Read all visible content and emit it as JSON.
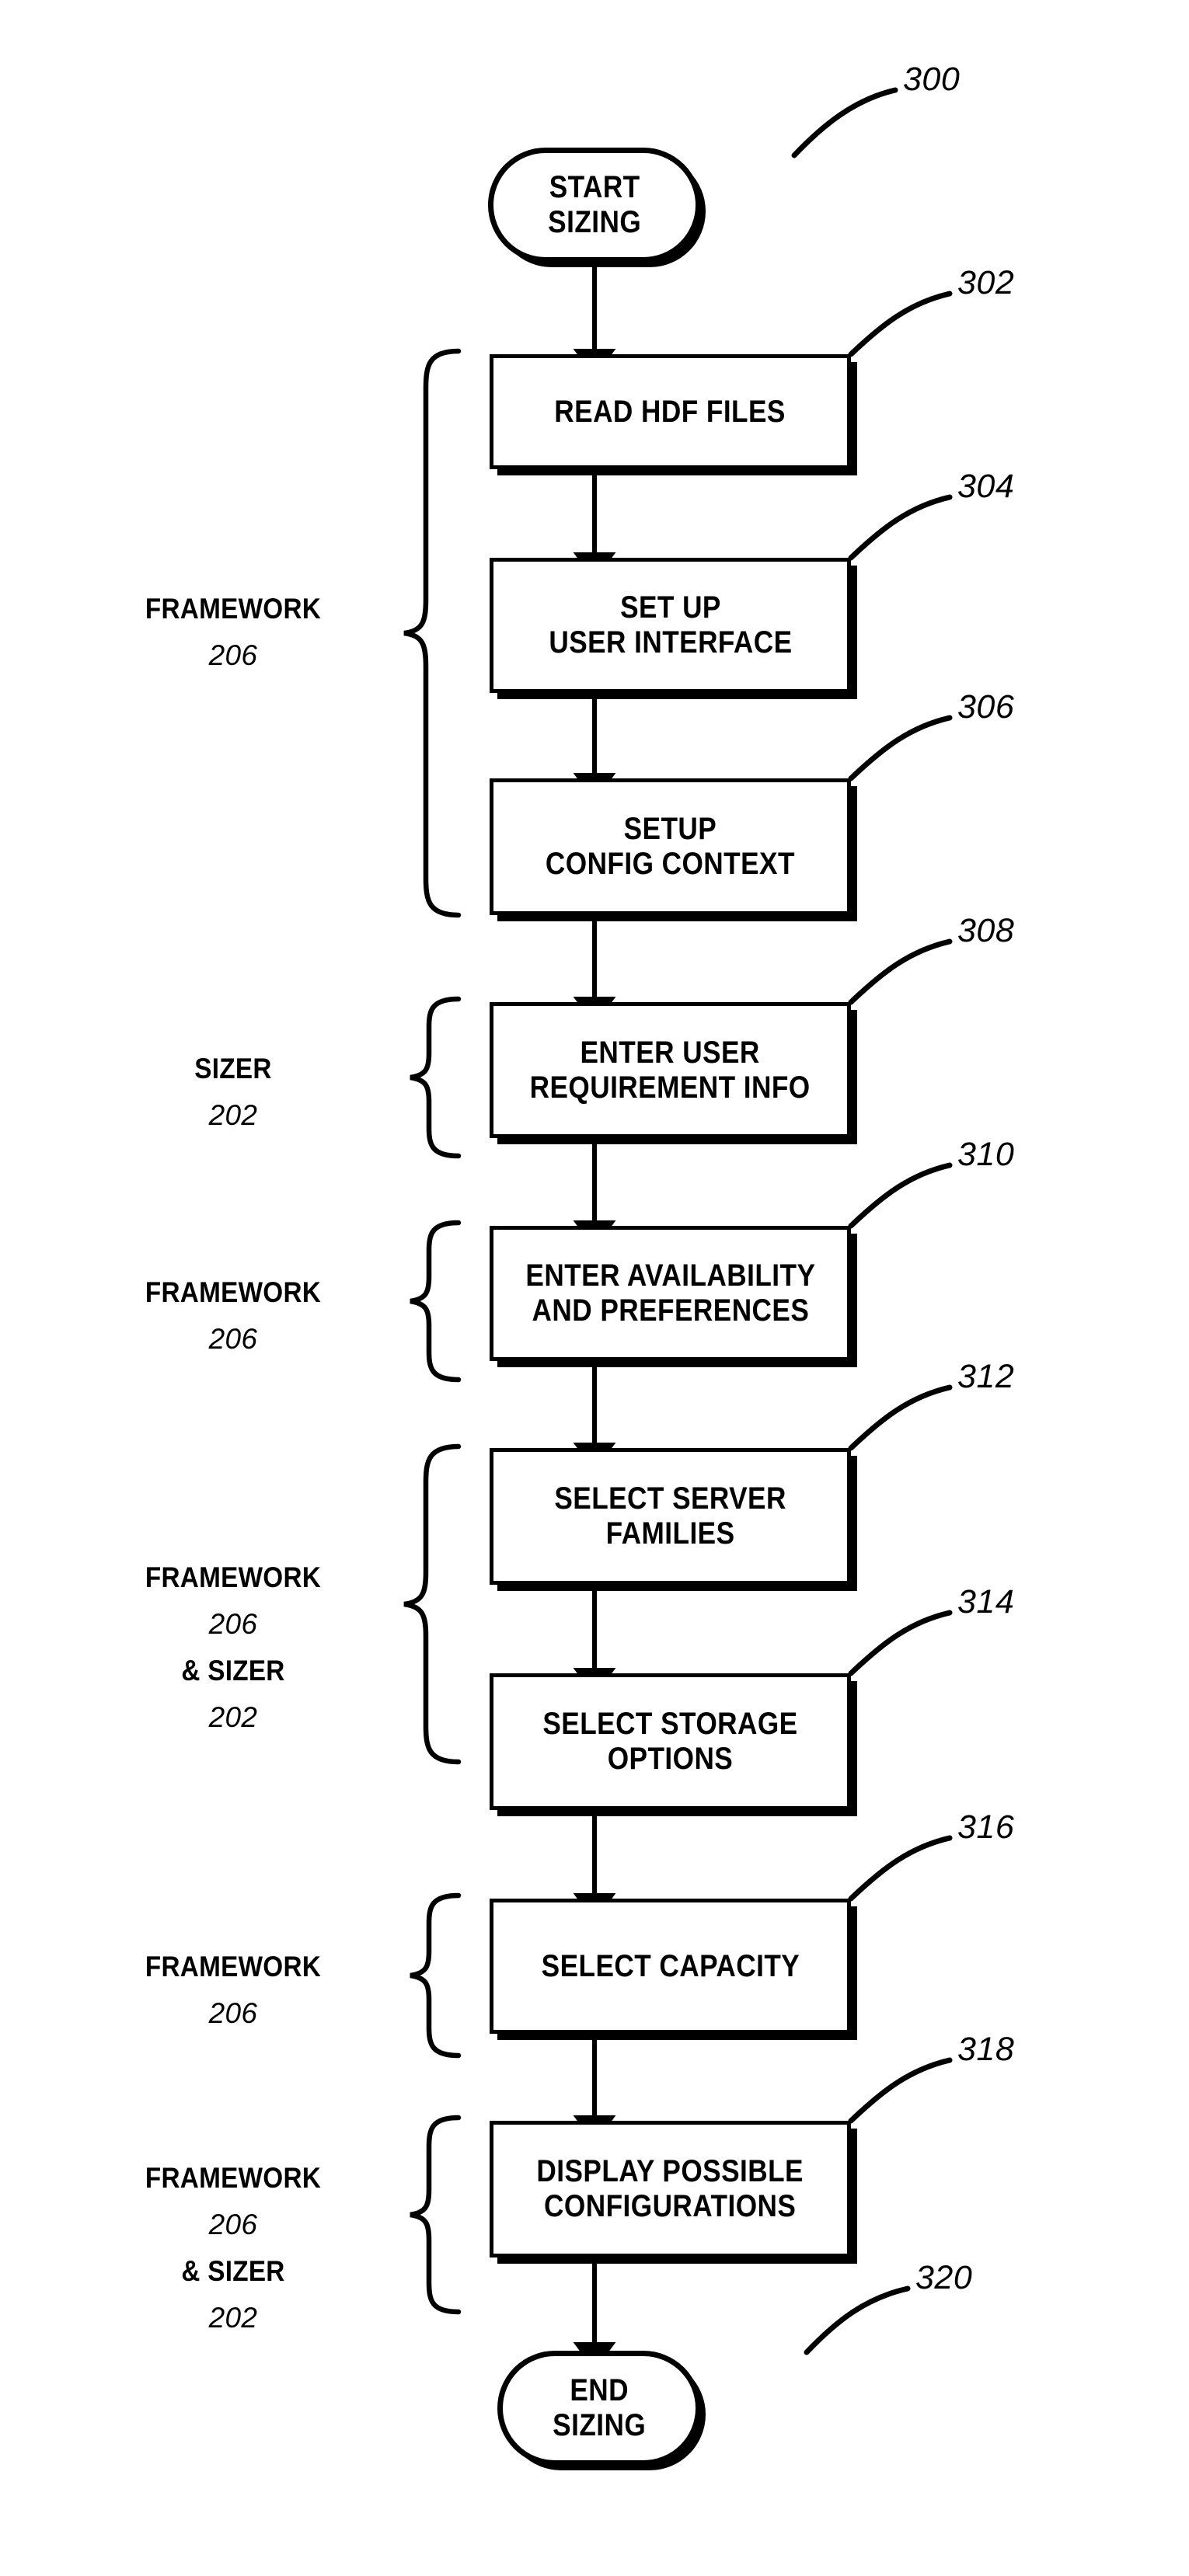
{
  "figure": {
    "title": "Sizing process flowchart",
    "ink_color": "#000000",
    "background_color": "#ffffff"
  },
  "nodes": [
    {
      "id": "start",
      "shape": "terminal",
      "label": "START\nSIZING",
      "ref": "300"
    },
    {
      "id": "read-hdf-files",
      "shape": "process",
      "label": "READ HDF FILES",
      "ref": "302"
    },
    {
      "id": "set-up-user-interface",
      "shape": "process",
      "label": "SET UP\nUSER INTERFACE",
      "ref": "304"
    },
    {
      "id": "setup-config-context",
      "shape": "process",
      "label": "SETUP\nCONFIG CONTEXT",
      "ref": "306"
    },
    {
      "id": "enter-user-requirement-info",
      "shape": "process",
      "label": "ENTER USER\nREQUIREMENT INFO",
      "ref": "308"
    },
    {
      "id": "enter-availability-and-preferences",
      "shape": "process",
      "label": "ENTER AVAILABILITY\nAND PREFERENCES",
      "ref": "310"
    },
    {
      "id": "select-server-families",
      "shape": "process",
      "label": "SELECT SERVER\nFAMILIES",
      "ref": "312"
    },
    {
      "id": "select-storage-options",
      "shape": "process",
      "label": "SELECT STORAGE\nOPTIONS",
      "ref": "314"
    },
    {
      "id": "select-capacity",
      "shape": "process",
      "label": "SELECT CAPACITY",
      "ref": "316"
    },
    {
      "id": "display-possible-configurations",
      "shape": "process",
      "label": "DISPLAY POSSIBLE\nCONFIGURATIONS",
      "ref": "318"
    },
    {
      "id": "end",
      "shape": "terminal",
      "label": "END\nSIZING",
      "ref": "320"
    }
  ],
  "groups": [
    {
      "id": "group-framework-1",
      "lines": [
        {
          "text": "FRAMEWORK",
          "style": "name"
        },
        {
          "text": "206",
          "style": "num"
        }
      ],
      "covers": [
        "read-hdf-files",
        "set-up-user-interface",
        "setup-config-context"
      ]
    },
    {
      "id": "group-sizer-1",
      "lines": [
        {
          "text": "SIZER",
          "style": "name"
        },
        {
          "text": "202",
          "style": "num"
        }
      ],
      "covers": [
        "enter-user-requirement-info"
      ]
    },
    {
      "id": "group-framework-2",
      "lines": [
        {
          "text": "FRAMEWORK",
          "style": "name"
        },
        {
          "text": "206",
          "style": "num"
        }
      ],
      "covers": [
        "enter-availability-and-preferences"
      ]
    },
    {
      "id": "group-framework-sizer-1",
      "lines": [
        {
          "text": "FRAMEWORK",
          "style": "name"
        },
        {
          "text": "206",
          "style": "num"
        },
        {
          "text": "& SIZER",
          "style": "name"
        },
        {
          "text": "202",
          "style": "num"
        }
      ],
      "covers": [
        "select-server-families",
        "select-storage-options"
      ]
    },
    {
      "id": "group-framework-3",
      "lines": [
        {
          "text": "FRAMEWORK",
          "style": "name"
        },
        {
          "text": "206",
          "style": "num"
        }
      ],
      "covers": [
        "select-capacity"
      ]
    },
    {
      "id": "group-framework-sizer-2",
      "lines": [
        {
          "text": "FRAMEWORK",
          "style": "name"
        },
        {
          "text": "206",
          "style": "num"
        },
        {
          "text": "& SIZER",
          "style": "name"
        },
        {
          "text": "202",
          "style": "num"
        }
      ],
      "covers": [
        "display-possible-configurations"
      ]
    }
  ],
  "flow_edges": [
    {
      "from": "start",
      "to": "read-hdf-files"
    },
    {
      "from": "read-hdf-files",
      "to": "set-up-user-interface"
    },
    {
      "from": "set-up-user-interface",
      "to": "setup-config-context"
    },
    {
      "from": "setup-config-context",
      "to": "enter-user-requirement-info"
    },
    {
      "from": "enter-user-requirement-info",
      "to": "enter-availability-and-preferences"
    },
    {
      "from": "enter-availability-and-preferences",
      "to": "select-server-families"
    },
    {
      "from": "select-server-families",
      "to": "select-storage-options"
    },
    {
      "from": "select-storage-options",
      "to": "select-capacity"
    },
    {
      "from": "select-capacity",
      "to": "display-possible-configurations"
    },
    {
      "from": "display-possible-configurations",
      "to": "end"
    }
  ]
}
